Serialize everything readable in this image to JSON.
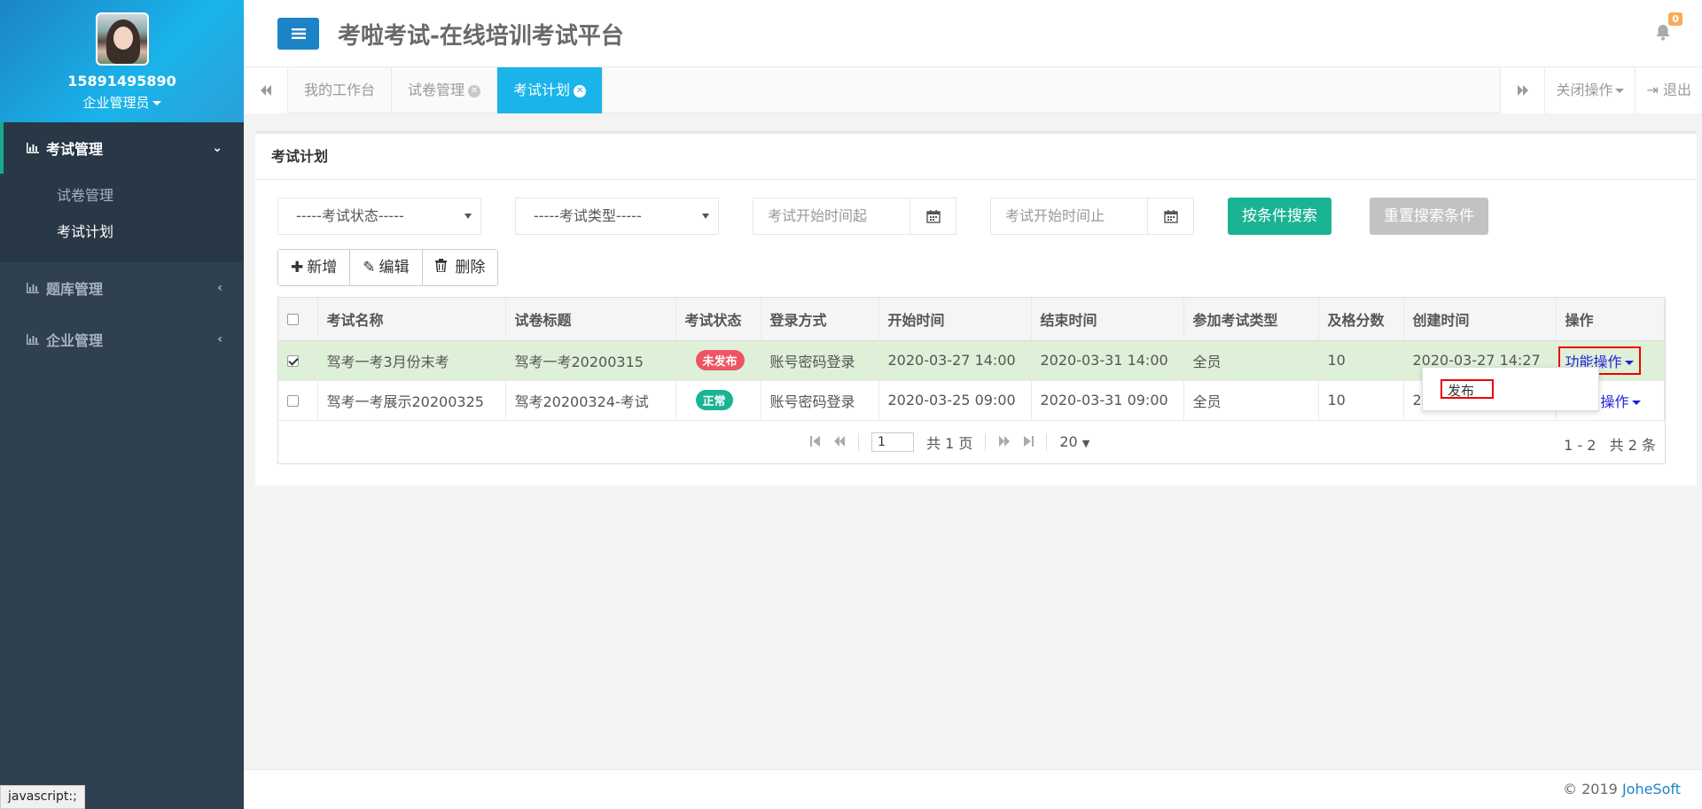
{
  "sidebar": {
    "phone": "15891495890",
    "role": "企业管理员",
    "menus": [
      {
        "label": "考试管理",
        "arrow": "⌄",
        "children": [
          "试卷管理",
          "考试计划"
        ]
      },
      {
        "label": "题库管理",
        "arrow": "‹"
      },
      {
        "label": "企业管理",
        "arrow": "‹"
      }
    ]
  },
  "header": {
    "title": "考啦考试-在线培训考试平台",
    "notification_count": "0"
  },
  "tabs": {
    "items": [
      "我的工作台",
      "试卷管理",
      "考试计划"
    ],
    "close_ops": "关闭操作",
    "logout": "退出"
  },
  "panel": {
    "title": "考试计划"
  },
  "filters": {
    "status_select": "-----考试状态-----",
    "type_select": "-----考试类型-----",
    "start_from_placeholder": "考试开始时间起",
    "start_to_placeholder": "考试开始时间止",
    "search_label": "按条件搜索",
    "reset_label": "重置搜索条件"
  },
  "toolbar": {
    "add": "新增",
    "edit": "编辑",
    "delete": "删除"
  },
  "table": {
    "headers": [
      "考试名称",
      "试卷标题",
      "考试状态",
      "登录方式",
      "开始时间",
      "结束时间",
      "参加考试类型",
      "及格分数",
      "创建时间",
      "操作"
    ],
    "rows": [
      {
        "name": "驾考一考3月份末考",
        "paper": "驾考一考20200315",
        "status": "未发布",
        "login": "账号密码登录",
        "start": "2020-03-27 14:00",
        "end": "2020-03-31 14:00",
        "type": "全员",
        "pass": "10",
        "created": "2020-03-27 14:27",
        "ops": "功能操作"
      },
      {
        "name": "驾考一考展示20200325",
        "paper": "驾考20200324-考试",
        "status": "正常",
        "login": "账号密码登录",
        "start": "2020-03-25 09:00",
        "end": "2020-03-31 09:00",
        "type": "全员",
        "pass": "10",
        "created": "2",
        "ops": "操作"
      }
    ]
  },
  "pagination": {
    "page": "1",
    "total_pages": "共 1 页",
    "page_size": "20",
    "range": "1 - 2",
    "total": "共 2 条"
  },
  "dropdown": {
    "item": "发布"
  },
  "footer": {
    "copyright": "© 2019",
    "brand": "JoheSoft"
  },
  "status_bar": "javascript:;",
  "colors": {
    "sidebar_bg": "#2f4050",
    "primary_blue": "#1c84c6",
    "active_tab": "#1ab4ea",
    "success_green": "#1ab394",
    "unpublished_red": "#ed5565",
    "normal_green": "#1ab394"
  }
}
